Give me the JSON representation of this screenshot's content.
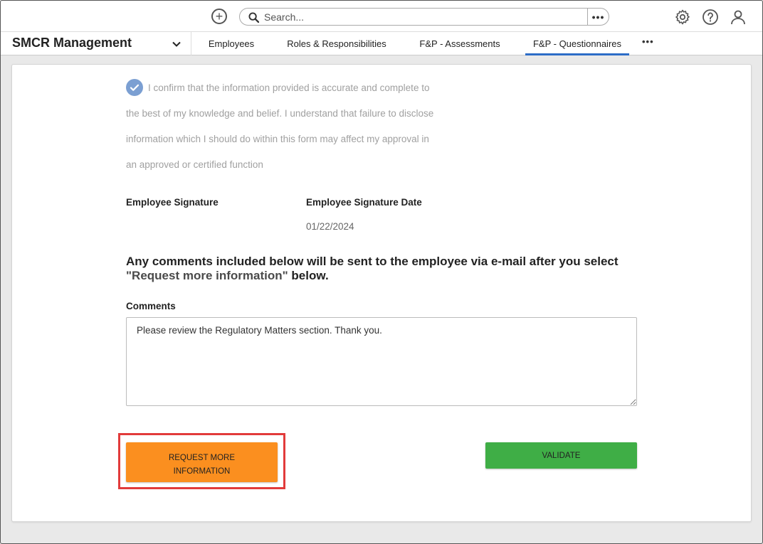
{
  "header": {
    "search_placeholder": "Search...",
    "search_more": "•••",
    "plus_icon": "plus-circle-icon",
    "icons": [
      "gear-icon",
      "help-icon",
      "user-icon"
    ]
  },
  "nav": {
    "app_title": "SMCR Management",
    "tabs": [
      {
        "label": "Employees",
        "active": false
      },
      {
        "label": "Roles & Responsibilities",
        "active": false
      },
      {
        "label": "F&P - Assessments",
        "active": false
      },
      {
        "label": "F&P - Questionnaires",
        "active": true
      }
    ],
    "more": "•••",
    "active_color": "#2d6dc7"
  },
  "form": {
    "confirmation": {
      "checked": true,
      "lines": [
        "I confirm that the information provided is accurate and complete to",
        "the best of my knowledge and belief. I understand that failure to disclose",
        "information which I should do within this form may affect my approval in",
        "an approved or certified function"
      ]
    },
    "signature_label": "Employee Signature",
    "signature_date_label": "Employee Signature Date",
    "signature_date": "01/22/2024",
    "notice_part1": "Any comments included below will be sent to the employee via e-mail after you select",
    "notice_quoted": "\"Request more information\"",
    "notice_part2": " below.",
    "comments_label": "Comments",
    "comments_value": "Please review the Regulatory Matters section. Thank you."
  },
  "actions": {
    "request_label": "REQUEST MORE INFORMATION",
    "validate_label": "VALIDATE",
    "request_color": "#fb8f1f",
    "validate_color": "#3fae46",
    "highlight_color": "#e23b3b"
  }
}
